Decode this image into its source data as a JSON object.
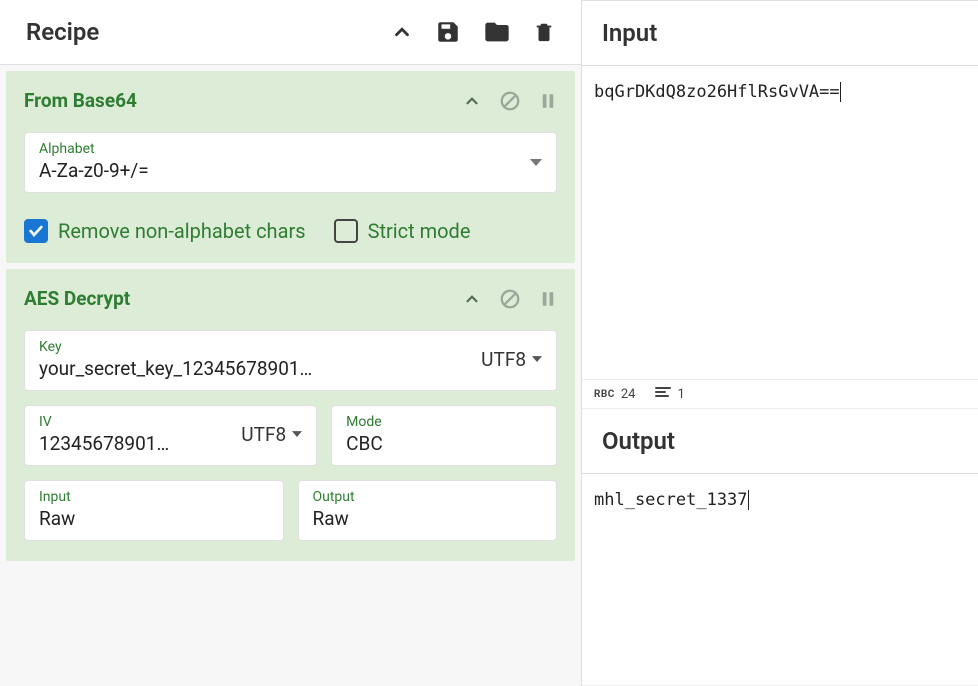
{
  "recipe": {
    "title": "Recipe",
    "operations": [
      {
        "name": "From Base64",
        "alphabet_label": "Alphabet",
        "alphabet_value": "A-Za-z0-9+/=",
        "remove_nonalpha_label": "Remove non-alphabet chars",
        "remove_nonalpha_checked": true,
        "strict_label": "Strict mode",
        "strict_checked": false
      },
      {
        "name": "AES Decrypt",
        "key_label": "Key",
        "key_value": "your_secret_key_12345678901…",
        "key_encoding": "UTF8",
        "iv_label": "IV",
        "iv_value": "12345678901…",
        "iv_encoding": "UTF8",
        "mode_label": "Mode",
        "mode_value": "CBC",
        "input_label": "Input",
        "input_value": "Raw",
        "output_label": "Output",
        "output_value": "Raw"
      }
    ]
  },
  "input": {
    "title": "Input",
    "value": "bqGrDKdQ8zo26HflRsGvVA=="
  },
  "status": {
    "chars": "24",
    "lines": "1"
  },
  "output": {
    "title": "Output",
    "value": "mhl_secret_1337"
  },
  "icons": {
    "collapse": "collapse-icon",
    "save": "save-icon",
    "folder": "folder-icon",
    "trash": "trash-icon",
    "chevron_up": "chevron-up-icon",
    "disable": "disable-icon",
    "pause": "pause-icon",
    "caret_down": "caret-down-icon",
    "abc": "abc-icon",
    "lines": "lines-icon"
  }
}
